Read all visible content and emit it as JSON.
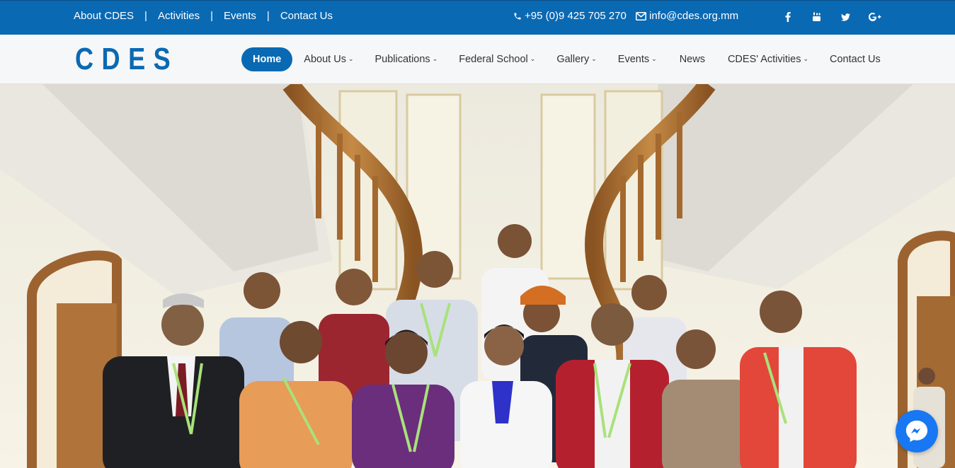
{
  "topbar": {
    "links": [
      "About CDES",
      "Activities",
      "Events",
      "Contact Us"
    ],
    "separator": "|",
    "phone": "+95 (0)9 425 705 270",
    "email": "info@cdes.org.mm",
    "social_icons": [
      "facebook-icon",
      "youtube-icon",
      "twitter-icon",
      "google-plus-icon"
    ]
  },
  "brand": {
    "logo_text": "CDES"
  },
  "nav": {
    "items": [
      {
        "label": "Home",
        "active": true,
        "dropdown": false
      },
      {
        "label": "About Us",
        "dropdown": true
      },
      {
        "label": "Publications",
        "dropdown": true
      },
      {
        "label": "Federal School",
        "dropdown": true
      },
      {
        "label": "Gallery",
        "dropdown": true
      },
      {
        "label": "Events",
        "dropdown": true
      },
      {
        "label": "News",
        "dropdown": false
      },
      {
        "label": "CDES' Activities",
        "dropdown": true
      },
      {
        "label": "Contact Us",
        "dropdown": false
      }
    ]
  },
  "hero": {
    "image": "group-photo",
    "chat_widget": "messenger-icon"
  },
  "colors": {
    "brand_blue": "#0a69b3",
    "nav_bg": "#f6f7f8",
    "messenger": "#1877f2"
  }
}
